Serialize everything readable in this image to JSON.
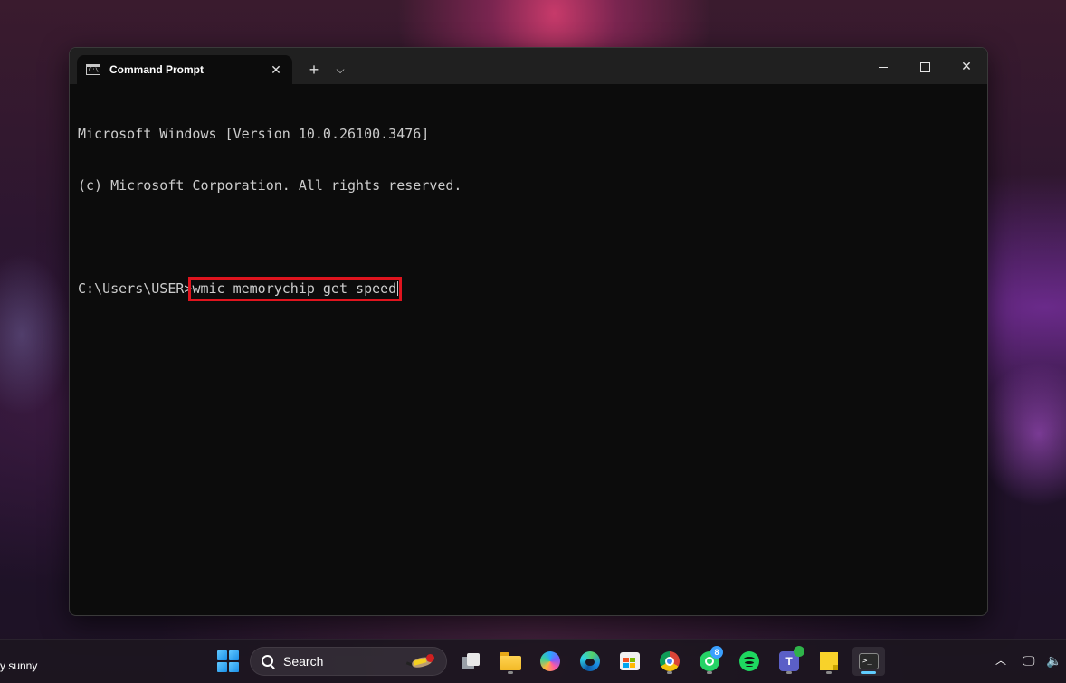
{
  "window": {
    "tab_title": "Command Prompt",
    "tab_icon_text": "C:\\",
    "new_tab_symbol": "+",
    "dropdown_symbol": "⌵",
    "close_symbol": "✕"
  },
  "console": {
    "lines": [
      "Microsoft Windows [Version 10.0.26100.3476]",
      "(c) Microsoft Corporation. All rights reserved."
    ],
    "prompt": "C:\\Users\\USER>",
    "command": "wmic memorychip get speed",
    "highlight_color": "#e0141e"
  },
  "taskbar": {
    "weather_text": "y sunny",
    "search_placeholder": "Search",
    "whatsapp_badge": "8",
    "teams_letter": "T",
    "terminal_glyph": ">_",
    "tray_chevron": "︿",
    "tray_monitor_symbol": "🖵",
    "tray_volume_symbol": "🔈",
    "apps": [
      "task-view",
      "file-explorer",
      "copilot",
      "edge",
      "microsoft-store",
      "chrome",
      "whatsapp",
      "spotify",
      "teams",
      "sticky-notes",
      "terminal"
    ]
  }
}
